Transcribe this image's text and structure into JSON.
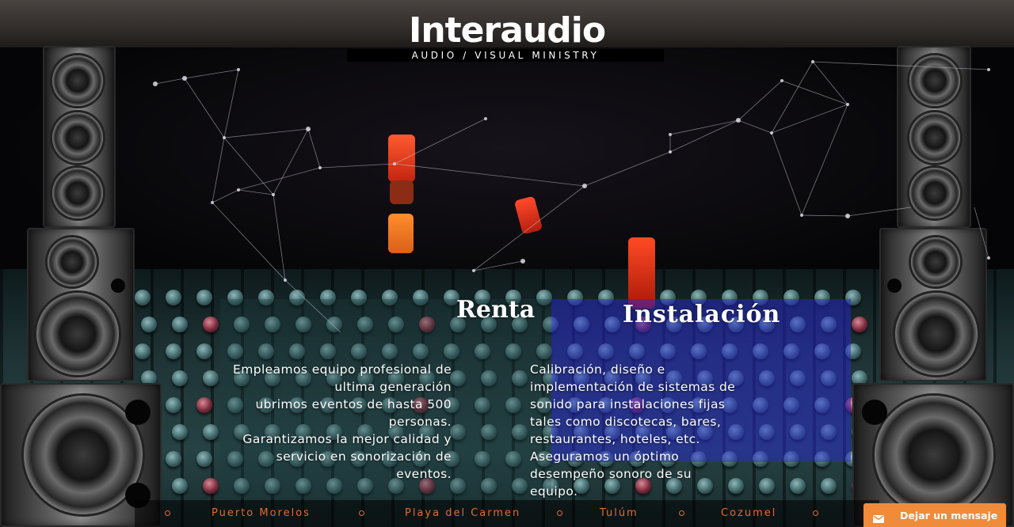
{
  "header": {
    "logo_text": "Interaudio",
    "tagline": "AUDIO / VISUAL MINISTRY"
  },
  "services": [
    {
      "title": "Renta",
      "lines": [
        "Empleamos equipo profesional de",
        "ultima generación",
        "ubrimos eventos de hasta 500",
        "personas.",
        "Garantizamos la mejor calidad y",
        "servicio en sonorización de",
        "eventos."
      ]
    },
    {
      "title": "Instalación",
      "lines": [
        "Calibración, diseño e",
        "implementación de sistemas de",
        "sonido para  instalaciones fijas",
        "tales como discotecas, bares,",
        "restaurantes, hoteles, etc.",
        "Aseguramos un óptimo",
        "desempeño sonoro de su",
        "equipo."
      ]
    }
  ],
  "locations": [
    "Puerto Morelos",
    "Playa del Carmen",
    "Tulúm",
    "Cozumel"
  ],
  "message_widget": {
    "label": "Dejar un mensaje",
    "icon": "envelope-icon",
    "color": "#f08b3a"
  },
  "colors": {
    "location_link": "#e8692a",
    "installation_panel": "#2828d2"
  }
}
